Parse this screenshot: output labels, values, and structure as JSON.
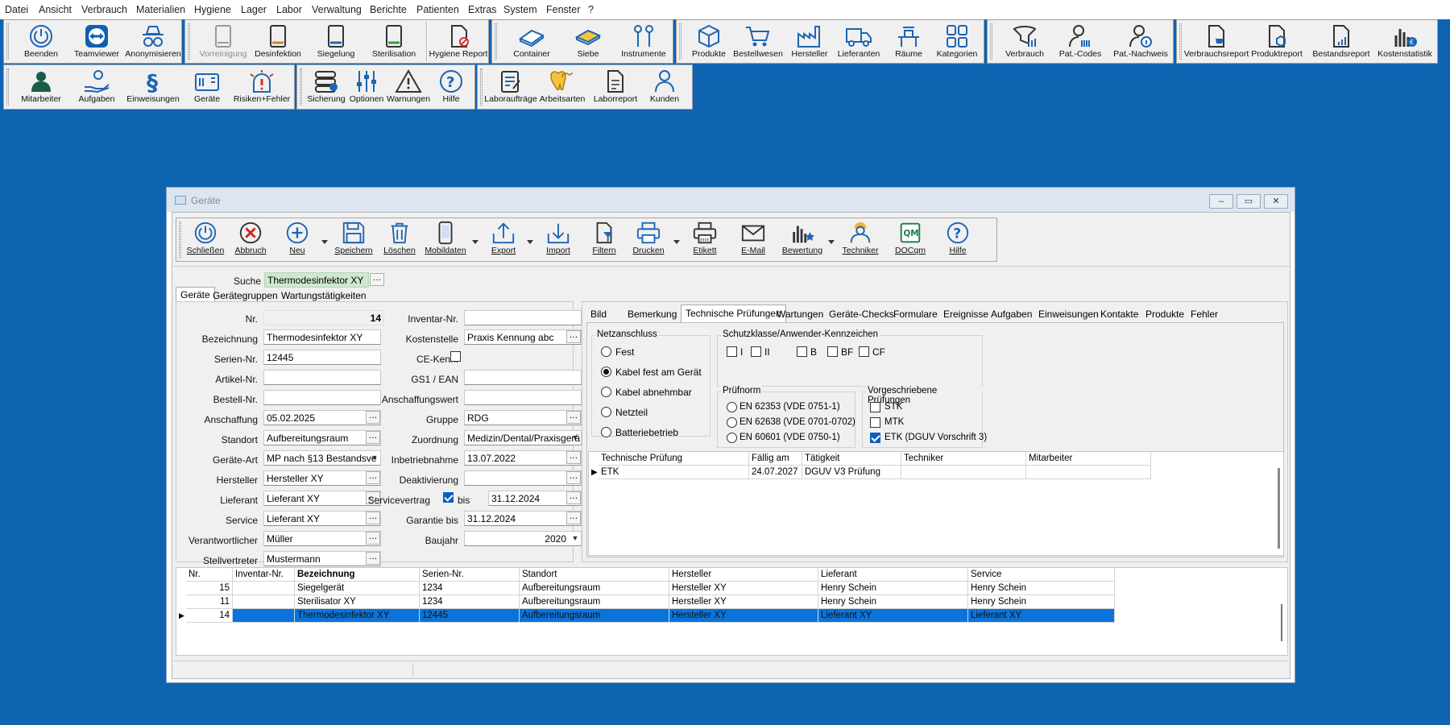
{
  "menu": [
    "Datei",
    "Ansicht",
    "Verbrauch",
    "Materialien",
    "Hygiene",
    "Lager",
    "Labor",
    "Verwaltung",
    "Berichte",
    "Patienten",
    "Extras",
    "System",
    "Fenster",
    "?"
  ],
  "toolbar_row1": {
    "group1": [
      "Beenden",
      "Teamviewer",
      "Anonymisieren"
    ],
    "group2": [
      "Vorreinigung",
      "Desinfektion",
      "Siegelung",
      "Sterilisation",
      "Hygiene Report"
    ],
    "group3": [
      "Container",
      "Siebe",
      "Instrumente"
    ],
    "group4": [
      "Produkte",
      "Bestellwesen",
      "Hersteller",
      "Lieferanten",
      "Räume",
      "Kategorien"
    ],
    "group5": [
      "Verbrauch",
      "Pat.-Codes",
      "Pat.-Nachweis"
    ],
    "group6": [
      "Verbrauchsreport",
      "Produktreport",
      "Bestandsreport",
      "Kostenstatistik"
    ]
  },
  "toolbar_row2": {
    "group1": [
      "Mitarbeiter",
      "Aufgaben",
      "Einweisungen",
      "Geräte",
      "Risiken+Fehler"
    ],
    "group2": [
      "Sicherung",
      "Optionen",
      "Warnungen",
      "Hilfe"
    ],
    "group3": [
      "Laboraufträge",
      "Arbeitsarten",
      "Laborreport",
      "Kunden"
    ]
  },
  "window": {
    "title": "Geräte",
    "toolbar": [
      "Schließen",
      "Abbruch",
      "Neu",
      "Speichern",
      "Löschen",
      "Mobildaten",
      "Export",
      "Import",
      "Filtern",
      "Drucken",
      "Etikett",
      "E-Mail",
      "Bewertung",
      "Techniker",
      "DOCqm",
      "Hilfe"
    ],
    "search_label": "Suche",
    "search_value": "Thermodesinfektor XY",
    "left_tabs": [
      "Geräte",
      "Gerätegruppen",
      "Wartungstätigkeiten"
    ],
    "form": {
      "nr_label": "Nr.",
      "nr": "14",
      "bezeichnung_label": "Bezeichnung",
      "bezeichnung": "Thermodesinfektor XY",
      "serien_label": "Serien-Nr.",
      "serien": "12445",
      "artikel_label": "Artikel-Nr.",
      "artikel": "",
      "bestell_label": "Bestell-Nr.",
      "bestell": "",
      "anschaffung_label": "Anschaffung",
      "anschaffung": "05.02.2025",
      "standort_label": "Standort",
      "standort": "Aufbereitungsraum",
      "geraeteart_label": "Geräte-Art",
      "geraeteart": "MP nach §13 Bestandsve",
      "hersteller_label": "Hersteller",
      "hersteller": "Hersteller XY",
      "lieferant_label": "Lieferant",
      "lieferant": "Lieferant XY",
      "service_label": "Service",
      "service": "Lieferant XY",
      "verantwortlicher_label": "Verantwortlicher",
      "verantwortlicher": "Müller",
      "stellvertreter_label": "Stellvertreter",
      "stellvertreter": "Mustermann",
      "inventar_label": "Inventar-Nr.",
      "inventar": "",
      "kostenstelle_label": "Kostenstelle",
      "kostenstelle": "Praxis Kennung abc",
      "ce_label": "CE-Kenn.",
      "gs1_label": "GS1 / EAN",
      "gs1": "",
      "anschaffungswert_label": "Anschaffungswert",
      "anschaffungswert": "",
      "gruppe_label": "Gruppe",
      "gruppe": "RDG",
      "zuordnung_label": "Zuordnung",
      "zuordnung": "Medizin/Dental/Praxisgerä",
      "inbetriebnahme_label": "Inbetriebnahme",
      "inbetriebnahme": "13.07.2022",
      "deaktivierung_label": "Deaktivierung",
      "deaktivierung": "",
      "servicevertrag_label": "Servicevertrag",
      "bis_label": "bis",
      "servicevertrag_bis": "31.12.2024",
      "garantie_label": "Garantie bis",
      "garantie": "31.12.2024",
      "baujahr_label": "Baujahr",
      "baujahr": "2020"
    },
    "right_tabs": [
      "Bild",
      "Bemerkung",
      "Technische Prüfungen",
      "Wartungen",
      "Geräte-Checks",
      "Formulare",
      "Ereignisse",
      "Aufgaben",
      "Einweisungen",
      "Kontakte",
      "Produkte",
      "Fehler"
    ],
    "netzanschluss": {
      "title": "Netzanschluss",
      "options": [
        "Fest",
        "Kabel fest am Gerät",
        "Kabel abnehmbar",
        "Netzteil",
        "Batteriebetrieb"
      ],
      "selected": 1
    },
    "schutzklasse": {
      "title": "Schutzklasse/Anwender-Kennzeichen",
      "options": [
        "I",
        "II",
        "B",
        "BF",
        "CF"
      ]
    },
    "pruefnorm": {
      "title": "Prüfnorm",
      "options": [
        "EN 62353 (VDE 0751-1)",
        "EN 62638 (VDE 0701-0702)",
        "EN 60601 (VDE 0750-1)"
      ]
    },
    "vorgeschrieben": {
      "title": "Vorgeschriebene Prüfungen",
      "options": [
        "STK",
        "MTK",
        "ETK (DGUV Vorschrift 3)"
      ],
      "checked": [
        false,
        false,
        true
      ]
    },
    "pruef_table": {
      "headers": [
        "Technische Prüfung",
        "Fällig am",
        "Tätigkeit",
        "Techniker",
        "Mitarbeiter"
      ],
      "rows": [
        [
          "ETK",
          "24.07.2027",
          "DGUV V3 Prüfung",
          "",
          ""
        ]
      ]
    },
    "list_table": {
      "headers": [
        "Nr.",
        "Inventar-Nr.",
        "Bezeichnung",
        "Serien-Nr.",
        "Standort",
        "Hersteller",
        "Lieferant",
        "Service"
      ],
      "rows": [
        [
          "15",
          "",
          "Siegelgerät",
          "1234",
          "Aufbereitungsraum",
          "Hersteller XY",
          "Henry Schein",
          "Henry Schein"
        ],
        [
          "11",
          "",
          "Sterilisator XY",
          "1234",
          "Aufbereitungsraum",
          "Hersteller XY",
          "Henry Schein",
          "Henry Schein"
        ],
        [
          "14",
          "",
          "Thermodesinfektor XY",
          "12445",
          "Aufbereitungsraum",
          "Hersteller XY",
          "Lieferant XY",
          "Lieferant XY"
        ]
      ],
      "selected_row": 2
    }
  },
  "colors": {
    "desktop": "#0f64b2",
    "selection": "#0a74da",
    "icon_blue": "#1e64b4"
  }
}
